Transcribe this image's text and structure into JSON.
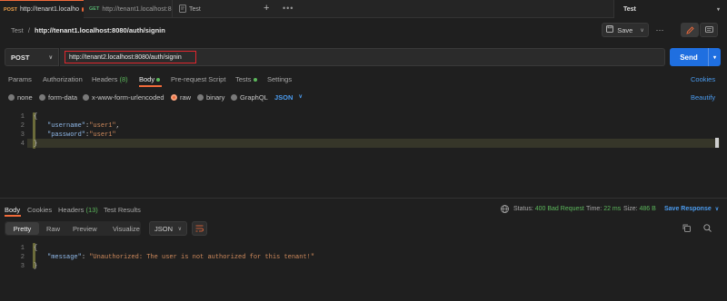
{
  "tabs": [
    {
      "method": "POST",
      "title": "http://tenant1.localho"
    },
    {
      "method": "GET",
      "title": "http://tenant1.localhost:8"
    },
    {
      "method": "",
      "title": "Test"
    }
  ],
  "environment": {
    "name": "Test"
  },
  "breadcrumb": {
    "collection": "Test",
    "separator": "/",
    "request": "http://tenant1.localhost:8080/auth/signin"
  },
  "toolbar": {
    "save_label": "Save"
  },
  "request": {
    "method": "POST",
    "url": "http://tenant2.localhost:8080/auth/signin",
    "send_label": "Send"
  },
  "request_tabs": {
    "params": "Params",
    "authorization": "Authorization",
    "headers": "Headers",
    "headers_count": "(8)",
    "body": "Body",
    "prerequest": "Pre-request Script",
    "tests": "Tests",
    "settings": "Settings",
    "cookies": "Cookies"
  },
  "body_types": {
    "none": "none",
    "form_data": "form-data",
    "urlencoded": "x-www-form-urlencoded",
    "raw": "raw",
    "binary": "binary",
    "graphql": "GraphQL",
    "format": "JSON",
    "beautify": "Beautify"
  },
  "request_body": {
    "line_numbers": [
      "1",
      "2",
      "3",
      "4"
    ],
    "open": "{",
    "k1": "\"username\"",
    "colon": ":",
    "v1": "\"user1\"",
    "comma": ",",
    "k2": "\"password\"",
    "v2": "\"user1\"",
    "close": "}"
  },
  "response_tabs": {
    "body": "Body",
    "cookies": "Cookies",
    "headers": "Headers",
    "headers_count": "(13)",
    "test_results": "Test Results"
  },
  "response_status": {
    "status_label": "Status:",
    "status_value": "400 Bad Request",
    "time_label": "Time:",
    "time_value": "22 ms",
    "size_label": "Size:",
    "size_value": "486 B",
    "save_response": "Save Response"
  },
  "response_view": {
    "pretty": "Pretty",
    "raw": "Raw",
    "preview": "Preview",
    "visualize": "Visualize",
    "format": "JSON"
  },
  "response_body": {
    "line_numbers": [
      "1",
      "2",
      "3"
    ],
    "open": "{",
    "key": "\"message\"",
    "colon": ": ",
    "value": "\"Unauthorized: The user is not authorized for this tenant!\"",
    "close": "}"
  },
  "colors": {
    "accent": "#f26b3a",
    "send": "#1f6fe0",
    "status_ok_text": "#5cb85c",
    "link": "#4b9cf0",
    "url_highlight": "#e0262e"
  }
}
